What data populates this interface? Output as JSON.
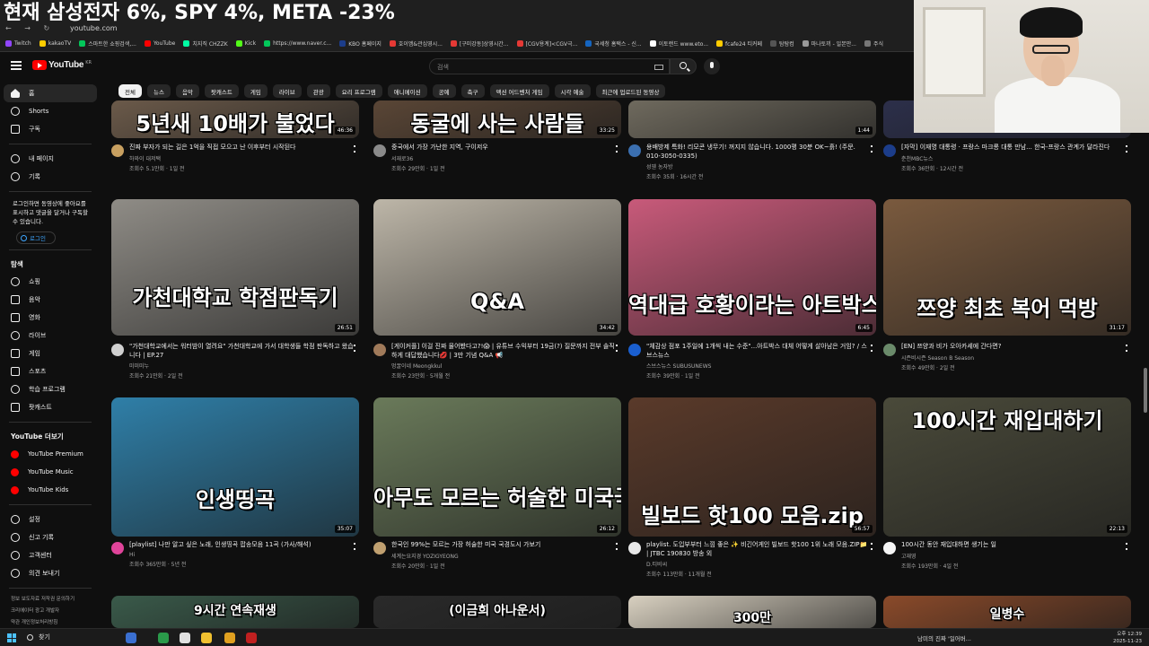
{
  "stream_title": "현재 삼성전자 6%, SPY 4%, META -23%",
  "browser": {
    "url": "youtube.com",
    "bookmarks": [
      "Twitch",
      "kakaoTV",
      "스마트한 쇼핑검색,...",
      "YouTube",
      "치지직 CHZZK",
      "Kick",
      "https://www.naver.c...",
      "KBO 홈페이지",
      "호이엠&관심영시...",
      "[구미강동]상영시간...",
      "[CGV용계]<CGV극...",
      "국세청 홈택스 - 신...",
      "이토랜드 www.eto...",
      "fcafe24 티커페",
      "탐탐컴",
      "마나토끼 - 일본만...",
      "주식"
    ]
  },
  "masthead": {
    "logo": "YouTube",
    "region": "KR",
    "search_placeholder": "검색"
  },
  "sidebar": {
    "main": [
      "홈",
      "Shorts",
      "구독"
    ],
    "you": [
      "내 페이지",
      "기록"
    ],
    "login_note": "로그인하면 동영상에 좋아요를 표시하고 댓글을 달거나 구독할 수 있습니다.",
    "login_label": "로그인",
    "explore_header": "탐색",
    "explore": [
      "쇼핑",
      "음악",
      "영화",
      "라이브",
      "게임",
      "스포츠",
      "학습 프로그램",
      "팟캐스트"
    ],
    "more_header": "YouTube 더보기",
    "more": [
      "YouTube Premium",
      "YouTube Music",
      "YouTube Kids"
    ],
    "settings": [
      "설정",
      "신고 기록",
      "고객센터",
      "의견 보내기"
    ],
    "footer": [
      "정보  보도자료  저작권  문의하기",
      "크리에이터  광고  개발자",
      "약관  개인정보처리방침",
      "정책 및 안전"
    ]
  },
  "chips": [
    "전체",
    "뉴스",
    "음악",
    "팟캐스트",
    "게임",
    "라이브",
    "관광",
    "요리 프로그램",
    "애니메이션",
    "공예",
    "축구",
    "액션 어드벤처 게임",
    "시각 예술",
    "최근에 업로드된 동영상"
  ],
  "videos": [
    {
      "thumb_text": "5년새 10배가 불었다",
      "duration": "46:36",
      "title": "진짜 부자가 되는 길은 1억을 직접 모으고 난 이후부터 시작된다",
      "channel": "하와이 대저택",
      "stats": "조회수 5.1만회 · 1일 전",
      "bg": "#6b5a4a",
      "avatar": "#c8a060"
    },
    {
      "thumb_text": "동굴에 사는 사람들",
      "duration": "33:25",
      "title": "중국에서 가장 가난한 지역, 구이저우",
      "channel": "서재로36",
      "stats": "조회수 29만회 · 1일 전",
      "bg": "#5a4636",
      "avatar": "#8a8a8a"
    },
    {
      "thumb_text": "",
      "duration": "1:44",
      "title": "용배방제 특화! 리모콘 냉무기! 꺼지지 않습니다. 1000평 30분 OK~흙! (주문. 010-3050-0335)",
      "channel": "성웬 농자방",
      "stats": "조회수 35회 · 16시간 전",
      "bg": "#6f6a5e",
      "avatar": "#3b6fb0"
    },
    {
      "thumb_text": "",
      "duration": "",
      "title": "[자막] 이재명 대통령 · 프랑스 마크롱 대통 만남... 한국-프랑스 관계가 달라진다",
      "channel": "춘천MBC뉴스",
      "stats": "조회수 36만회 · 12시간 전",
      "bg": "#2c2f4a",
      "avatar": "#1c3d8a"
    },
    {
      "thumb_text": "가천대학교 학점판독기",
      "duration": "26:51",
      "title": "\"가천대학교에서는 워터밤이 열려요\" 가천대학교에 가서 대학생들 학점 판독하고 왔습니다 | EP.27",
      "channel": "미미미누",
      "stats": "조회수 21만회 · 2일 전",
      "bg": "#8f8c86",
      "avatar": "#d0d0d0"
    },
    {
      "thumb_text": "Q&A",
      "duration": "34:42",
      "title": "[게이커플] 이걸 진짜 물어봤다고?!😱 | 유튜브 수익부터 19금(?) 질문까지 전부 솔직하게 대답했습니다💋 | 3만 기념 Q&A 📢",
      "channel": "멍꿀이네 Meongkkul",
      "stats": "조회수 23만회 · 5개월 전",
      "bg": "#bdb6a8",
      "avatar": "#a07a5a"
    },
    {
      "thumb_text": "역대급 호황이라는 아트박스",
      "duration": "6:45",
      "title": "\"체감상 점포 1주일에 1개씩 내는 수준\"...아트박스 대체 어떻게 살아남은 거임? / 스브스뉴스",
      "channel": "스브스뉴스 SUBUSUNEWS",
      "stats": "조회수 39만회 · 1일 전",
      "bg": "#c85a7a",
      "avatar": "#1a5fd0"
    },
    {
      "thumb_text": "쯔양 최초 복어 먹방",
      "duration": "31:17",
      "title": "[EN] 쯔양과 비가 오아카세에 간다면?",
      "channel": "시즌비시즌 Season B Season",
      "stats": "조회수 49만회 · 2일 전",
      "bg": "#7a5a3e",
      "avatar": "#6a8a6a"
    },
    {
      "thumb_text": "인생띵곡",
      "duration": "35:07",
      "title": "[playlist] 나만 알고 싶은 노래, 인생띵곡 팝송모음 11곡 (가사/해석)",
      "channel": "Hi",
      "stats": "조회수 365만회 · 5년 전",
      "bg": "#2f7fa8",
      "avatar": "#e0449a"
    },
    {
      "thumb_text": "아무도 모르는 허술한 미국국경",
      "duration": "26:12",
      "title": "한국인 99%는 모르는 가장 허술한 미국 국경도시 가보기",
      "channel": "세계는요지경 YOZIGYEONG",
      "stats": "조회수 20만회 · 1일 전",
      "bg": "#6a7a5a",
      "avatar": "#c0a070"
    },
    {
      "thumb_text": "빌보드 핫100 모음.zip",
      "duration": "56:57",
      "title": "playlist. 도입부부터 느낌 좋은 ✨ 비긴어게인 빌보드 핫100 1위 노래 모음.ZIP📁 | JTBC 190830 방송 외",
      "channel": "D.티비씨",
      "stats": "조회수 113만회 · 11개월 전",
      "bg": "#5a3a2a",
      "avatar": "#e8e8e8"
    },
    {
      "thumb_text": "100시간 재입대하기",
      "duration": "22:13",
      "title": "100시간 동안 재입대하면 생기는 일",
      "channel": "고재영",
      "stats": "조회수 193만회 · 4일 전",
      "bg": "#4a4a3a",
      "avatar": "#f5f5f5"
    },
    {
      "thumb_text": "9시간 연속재생",
      "bg": "#3a5a4a"
    },
    {
      "thumb_text": "(이금희 아나운서)",
      "bg": "#2a2a2a"
    },
    {
      "thumb_text": "300만",
      "bg": "#d8d0c0"
    },
    {
      "thumb_text": "일병수",
      "bg": "#8a4a2a"
    }
  ],
  "taskbar": {
    "search": "찾기",
    "media": "남미의 진짜 '일어버...",
    "time": "오후 12:39",
    "date": "2025-11-23"
  }
}
